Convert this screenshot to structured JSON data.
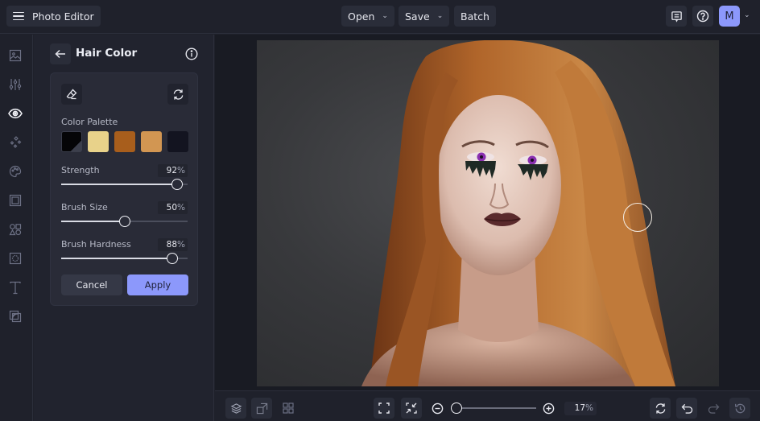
{
  "app": {
    "title": "Photo Editor",
    "menu_icon": "hamburger-menu-icon"
  },
  "toolbar": {
    "open_label": "Open",
    "save_label": "Save",
    "batch_label": "Batch",
    "feedback_icon": "comment-icon",
    "help_icon": "help-icon",
    "avatar_initial": "M"
  },
  "rail": {
    "items": [
      {
        "name": "image",
        "icon": "image-icon",
        "active": false
      },
      {
        "name": "adjustments",
        "icon": "sliders-icon",
        "active": false
      },
      {
        "name": "touch-up",
        "icon": "eye-icon",
        "active": true
      },
      {
        "name": "effects",
        "icon": "sparkles-icon",
        "active": false
      },
      {
        "name": "artsy",
        "icon": "palette-icon",
        "active": false
      },
      {
        "name": "frames",
        "icon": "frame-icon",
        "active": false
      },
      {
        "name": "graphics",
        "icon": "shapes-icon",
        "active": false
      },
      {
        "name": "overlays",
        "icon": "overlay-icon",
        "active": false
      },
      {
        "name": "text",
        "icon": "text-icon",
        "active": false
      },
      {
        "name": "textures",
        "icon": "texture-icon",
        "active": false
      }
    ]
  },
  "panel": {
    "title": "Hair Color",
    "palette_label": "Color Palette",
    "palette": [
      {
        "color": "#050507",
        "selected": true
      },
      {
        "color": "#e8d28a",
        "selected": false
      },
      {
        "color": "#a85e1c",
        "selected": false
      },
      {
        "color": "#d29652",
        "selected": false
      },
      {
        "color": "#131420",
        "selected": false
      }
    ],
    "sliders": [
      {
        "label": "Strength",
        "value": "92",
        "unit": "%",
        "fraction": 0.92
      },
      {
        "label": "Brush Size",
        "value": "50",
        "unit": "%",
        "fraction": 0.5
      },
      {
        "label": "Brush Hardness",
        "value": "88",
        "unit": "%",
        "fraction": 0.88
      }
    ],
    "cancel_label": "Cancel",
    "apply_label": "Apply"
  },
  "bottom": {
    "zoom_value": "17",
    "zoom_unit": "%",
    "zoom_fraction": 0.05
  },
  "colors": {
    "accent": "#8c98fb",
    "background": "#1f212b",
    "panel": "#21232e"
  }
}
